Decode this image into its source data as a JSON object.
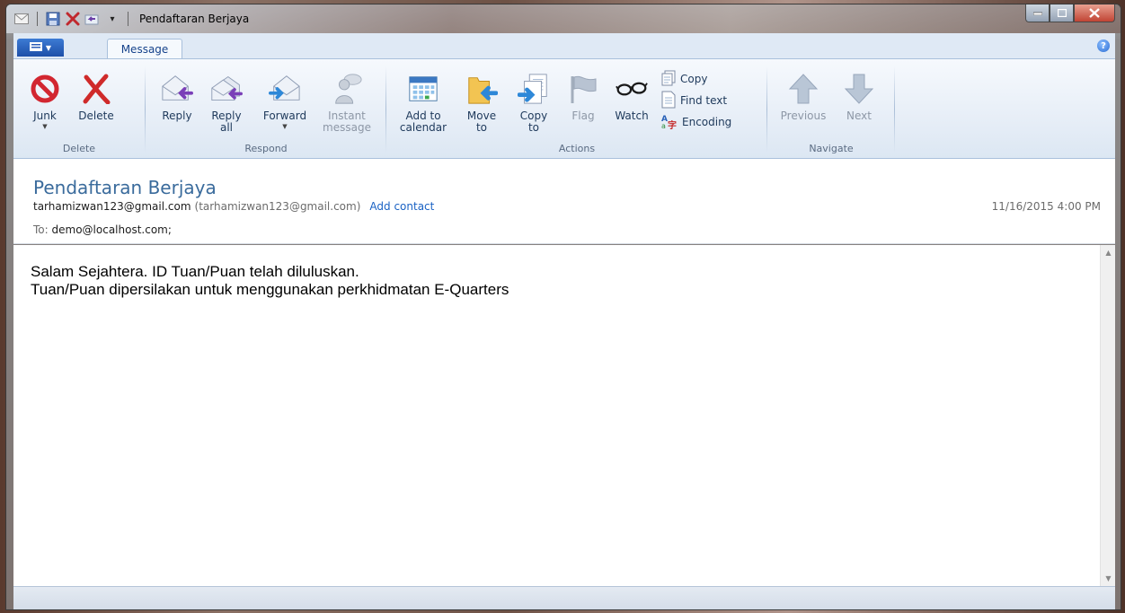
{
  "window": {
    "title": "Pendaftaran Berjaya"
  },
  "tabs": {
    "app_menu_icon": "menu-icon",
    "message": "Message"
  },
  "ribbon": {
    "groups": {
      "delete": "Delete",
      "respond": "Respond",
      "actions": "Actions",
      "navigate": "Navigate"
    },
    "buttons": {
      "junk": "Junk",
      "delete": "Delete",
      "reply": "Reply",
      "reply_all": "Reply\nall",
      "forward": "Forward",
      "instant_message": "Instant\nmessage",
      "add_to_calendar": "Add to\ncalendar",
      "move_to": "Move\nto",
      "copy_to": "Copy\nto",
      "flag": "Flag",
      "watch": "Watch",
      "copy": "Copy",
      "find_text": "Find text",
      "encoding": "Encoding",
      "previous": "Previous",
      "next": "Next"
    }
  },
  "message": {
    "subject": "Pendaftaran Berjaya",
    "from_name": "tarhamizwan123@gmail.com",
    "from_address": "(tarhamizwan123@gmail.com)",
    "add_contact": "Add contact",
    "date": "11/16/2015 4:00 PM",
    "to_label": "To:",
    "to_value": "demo@localhost.com;",
    "body_line1": "Salam Sejahtera. ID Tuan/Puan telah diluluskan.",
    "body_line2": "Tuan/Puan dipersilakan untuk menggunakan perkhidmatan E-Quarters"
  },
  "colors": {
    "accent": "#1a62c4",
    "subject": "#3a6b9c",
    "ribbon_text": "#1e395b"
  }
}
